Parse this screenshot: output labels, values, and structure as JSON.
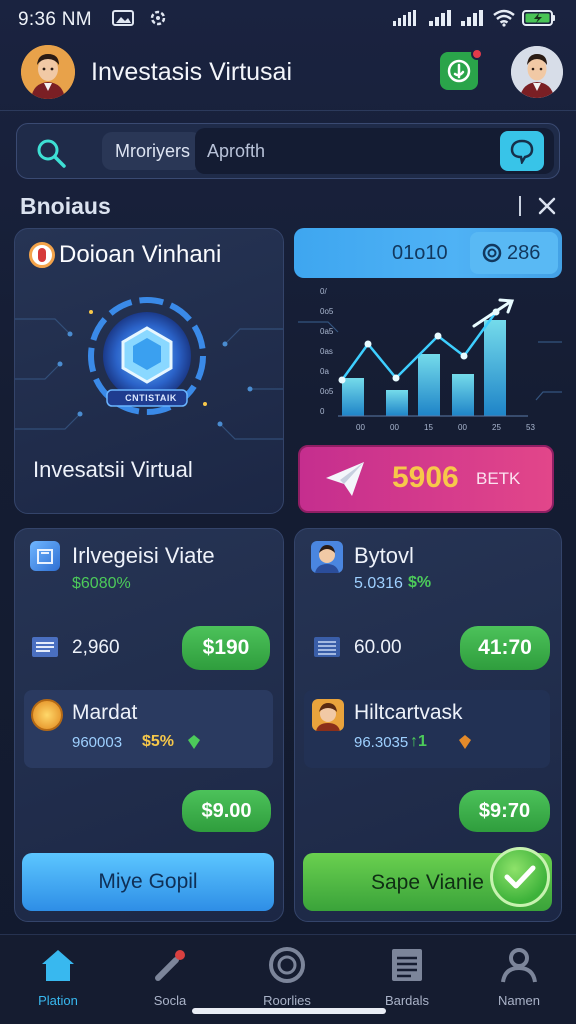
{
  "status_bar": {
    "time": "9:36 NM"
  },
  "header": {
    "title": "Investasis Virtusai"
  },
  "search": {
    "category": "Mroriyers",
    "placeholder": "Aprofth"
  },
  "section": {
    "title": "Bnoiaus"
  },
  "featured": {
    "title": "Doioan Vinhani",
    "emblem_text": "CNTISTAIK",
    "caption": "Invesatsii Virtual"
  },
  "stats": {
    "value_left": "01o10",
    "value_right": "286",
    "chart_ticks": [
      "0/",
      "0o5",
      "0a5",
      "0as",
      "0a",
      "0o5",
      "0"
    ],
    "x_ticks": [
      "00",
      "00",
      "15",
      "00",
      "25",
      "53"
    ],
    "action_value": "5906",
    "action_suffix": "BETK"
  },
  "left_card": {
    "title": "Irlvegeisi Viate",
    "subtitle": "$6080%",
    "metric": "2,960",
    "metric_button": "$190",
    "sub_item_title": "Mardat",
    "sub_item_value": "960003",
    "sub_item_pct": "$5%",
    "sub_button": "$9.00",
    "cta": "Miye Gopil"
  },
  "right_card": {
    "title": "Bytovl",
    "subtitle": "5.0316",
    "subtitle_badge": "$%",
    "metric": "60.00",
    "metric_button": "41:70",
    "sub_item_title": "Hiltcartvask",
    "sub_item_value": "96.3035",
    "sub_item_badge": "↑1",
    "sub_button": "$9:70",
    "cta": "Sape Vianie"
  },
  "nav": [
    {
      "label": "Plation",
      "icon": "home-icon",
      "active": true
    },
    {
      "label": "Socla",
      "icon": "tool-icon",
      "active": false
    },
    {
      "label": "Roorlies",
      "icon": "target-icon",
      "active": false
    },
    {
      "label": "Bardals",
      "icon": "document-icon",
      "active": false
    },
    {
      "label": "Namen",
      "icon": "user-icon",
      "active": false
    }
  ],
  "colors": {
    "background": "#151d33",
    "accent_blue": "#3ea6f0",
    "accent_green": "#3aad49",
    "accent_magenta": "#c52e8e",
    "gold": "#f7c84a"
  }
}
